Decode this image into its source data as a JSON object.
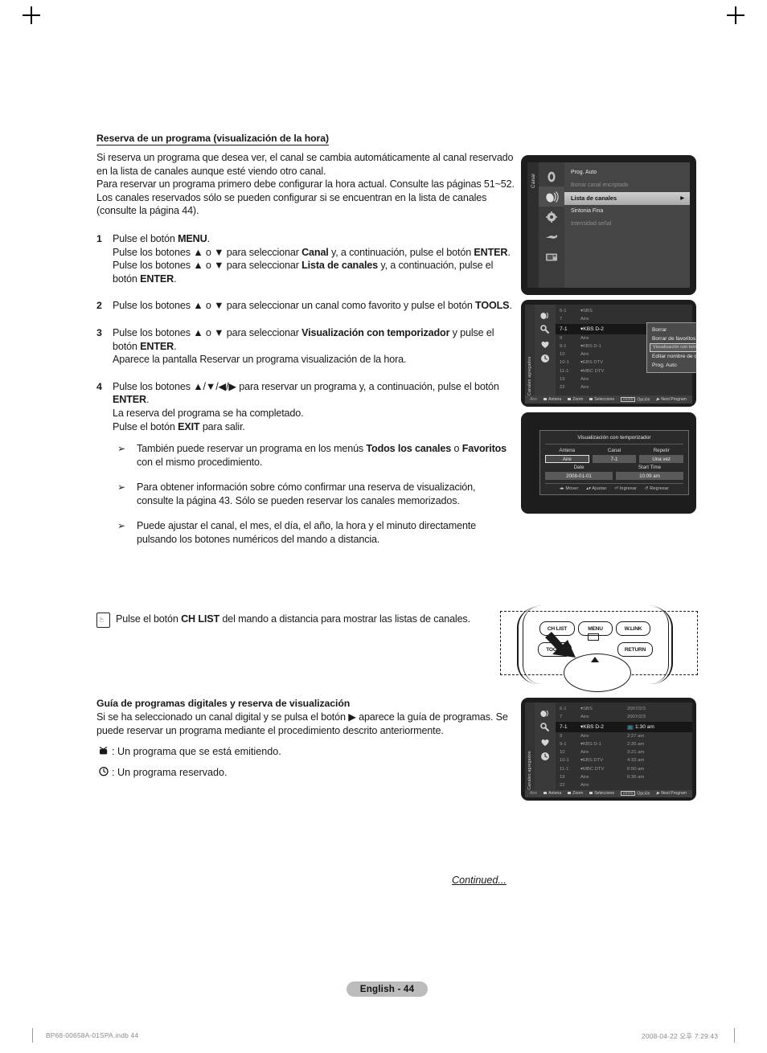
{
  "document": {
    "section1": {
      "title": "Reserva de un programa (visualización de la hora)",
      "intro": [
        "Si reserva un programa que desea ver, el canal se cambia automáticamente al canal reservado en la lista de canales aunque esté viendo otro canal.",
        "Para reservar un programa primero debe configurar la hora actual. Consulte las páginas 51~52. Los canales reservados sólo se pueden configurar si se encuentran en la lista de canales (consulte la página 44)."
      ],
      "steps": [
        {
          "num": "1",
          "lines": [
            "Pulse el botón MENU.",
            "Pulse los botones ▲ o ▼ para seleccionar Canal y, a continuación, pulse el botón ENTER.",
            "Pulse los botones ▲ o ▼ para seleccionar Lista de canales y, a continuación, pulse el botón ENTER."
          ]
        },
        {
          "num": "2",
          "lines": [
            "Pulse los botones ▲ o ▼ para seleccionar un canal como favorito y pulse el botón TOOLS."
          ]
        },
        {
          "num": "3",
          "lines": [
            "Pulse los botones ▲ o ▼ para seleccionar Visualización con temporizador y pulse el botón ENTER.",
            "Aparece la pantalla Reservar un programa visualización de la hora."
          ]
        },
        {
          "num": "4",
          "lines": [
            "Pulse los botones ▲/▼/◀/▶ para reservar un programa y, a continuación, pulse el botón ENTER.",
            "La reserva del programa se ha completado.",
            "Pulse el botón EXIT para salir."
          ]
        }
      ],
      "notes": [
        "También puede reservar un programa en los menús Todos los canales o Favoritos con el mismo procedimiento.",
        "Para obtener información sobre cómo confirmar una reserva de visualización, consulte la página 43. Sólo se pueden reservar los canales memorizados.",
        "Puede ajustar el canal, el mes, el día, el año, la hora y el minuto directamente pulsando los botones numéricos del mando a distancia."
      ],
      "note_marker": "➢",
      "tip": "Pulse el botón CH LIST del mando a distancia para mostrar las listas de canales."
    },
    "section2": {
      "title": "Guía de programas digitales y reserva de visualización",
      "body": "Si se ha seleccionado un canal digital y se pulsa el botón ▶ aparece la guía de programas. Se puede reservar un programa mediante el procedimiento descrito anteriormente.",
      "legend": [
        {
          "icon": "tv-icon",
          "glyph": "📺",
          "text": ": Un programa que se está emitiendo."
        },
        {
          "icon": "clock-icon",
          "glyph": "🕐",
          "text": ": Un programa reservado."
        }
      ]
    },
    "continued": "Continued...",
    "page_badge": "English - 44",
    "print_footer": {
      "left": "BP68-00658A-01SPA.indb   44",
      "right": "2008-04-22   오후 7:29:43"
    }
  },
  "tv_menu": {
    "tab_label": "Canal",
    "icons": [
      "picture-icon",
      "channel-icon",
      "setup-icon",
      "input-icon",
      "pc-icon"
    ],
    "selected_icon_index": 1,
    "items": [
      {
        "label": "Prog. Auto",
        "state": "normal"
      },
      {
        "label": "Borrar canal encriptado",
        "state": "dim"
      },
      {
        "label": "Lista de canales",
        "state": "selected",
        "arrow": "▶"
      },
      {
        "label": "Sintonia Fina",
        "state": "normal"
      },
      {
        "label": "Intensidad señal",
        "state": "dim"
      }
    ]
  },
  "channel_list": {
    "tab_label": "Canales agregados",
    "icons": [
      "antenna-icon",
      "tools-icon",
      "heart-icon",
      "clock-icon"
    ],
    "rows": [
      {
        "num": "6-1",
        "name": "▾SBS",
        "time": "",
        "selected": false
      },
      {
        "num": "7",
        "name": "Aire",
        "time": "",
        "selected": false
      },
      {
        "num": "7-1",
        "name": "▾KBS D-2",
        "time": "",
        "selected": true
      },
      {
        "num": "9",
        "name": "Aire",
        "time": "",
        "selected": false
      },
      {
        "num": "9-1",
        "name": "▾KBS D-1",
        "time": "",
        "selected": false
      },
      {
        "num": "10",
        "name": "Aire",
        "time": "",
        "selected": false
      },
      {
        "num": "10-1",
        "name": "▾EBS DTV",
        "time": "",
        "selected": false
      },
      {
        "num": "11-1",
        "name": "▾MBC DTV",
        "time": "",
        "selected": false
      },
      {
        "num": "19",
        "name": "Aire",
        "time": "",
        "selected": false
      },
      {
        "num": "22",
        "name": "Aire",
        "time": "",
        "selected": false
      }
    ],
    "popup": {
      "items": [
        {
          "label": "Borrar",
          "selected": false
        },
        {
          "label": "Borrar de favoritos",
          "selected": false
        },
        {
          "label": "Visualización con temporizador",
          "selected": true
        },
        {
          "label": "Editar nombre de canal",
          "selected": false
        },
        {
          "label": "Prog. Auto",
          "selected": false
        }
      ]
    },
    "bottom_bar": {
      "source": "Aire",
      "keys": [
        "Antena",
        "Zoom",
        "Seleccione",
        "Opción",
        "Next Program"
      ],
      "enter_key_label": "ENTER"
    }
  },
  "timer_dialog": {
    "title": "Visualización con temporizador",
    "fields": [
      {
        "label": "Antena",
        "value": "Aire",
        "highlighted": true
      },
      {
        "label": "Canal",
        "value": "7-1",
        "highlighted": false
      },
      {
        "label": "Repetir",
        "value": "Una vez",
        "highlighted": false
      },
      {
        "label": "Date",
        "value": "2008-01-01",
        "highlighted": false
      },
      {
        "label": "Start Time",
        "value": "10:09 am",
        "highlighted": false
      }
    ],
    "footer": [
      "◂▸ Mover",
      "▴▾ Ajustar",
      "⏎ Ingresar",
      "↺ Regresar"
    ]
  },
  "guide_list": {
    "tab_label": "Canales agregados",
    "icons": [
      "antenna-icon",
      "tools-icon",
      "heart-icon",
      "clock-icon"
    ],
    "rows": [
      {
        "num": "6-1",
        "name": "▾SBS",
        "time": "2007/2/3",
        "selected": false
      },
      {
        "num": "7",
        "name": "Aire",
        "time": "2007/2/3",
        "selected": false
      },
      {
        "num": "7-1",
        "name": "▾KBS D-2",
        "time": "📺 1:30  am",
        "selected": true
      },
      {
        "num": "9",
        "name": "Aire",
        "time": "2:27  am",
        "selected": false
      },
      {
        "num": "9-1",
        "name": "▾KBS D-1",
        "time": "2:35  am",
        "selected": false
      },
      {
        "num": "10",
        "name": "Aire",
        "time": "3:21  am",
        "selected": false
      },
      {
        "num": "10-1",
        "name": "▾EBS DTV",
        "time": "4:33  am",
        "selected": false
      },
      {
        "num": "11-1",
        "name": "▾MBC DTV",
        "time": "6:00  am",
        "selected": false
      },
      {
        "num": "19",
        "name": "Aire",
        "time": "6:36  am",
        "selected": false
      },
      {
        "num": "22",
        "name": "Aire",
        "time": "",
        "selected": false
      }
    ],
    "bottom_bar": {
      "source": "Aire",
      "keys": [
        "Antena",
        "Zoom",
        "Seleccione",
        "Opción",
        "Next Program"
      ],
      "enter_key_label": "ENTER"
    }
  },
  "remote": {
    "buttons": [
      {
        "label": "CH LIST",
        "name": "ch-list-button"
      },
      {
        "label": "MENU",
        "name": "menu-button"
      },
      {
        "label": "W.LINK",
        "name": "wlink-button"
      },
      {
        "label": "TOOLS",
        "name": "tools-button"
      },
      {
        "label": "RETURN",
        "name": "return-button"
      }
    ]
  }
}
